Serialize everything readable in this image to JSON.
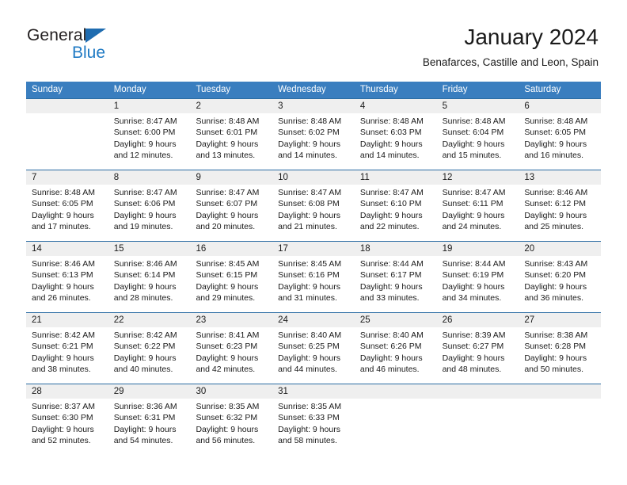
{
  "brand": {
    "name_part1": "General",
    "name_part2": "Blue",
    "triangle_icon": "triangle-icon",
    "color_dark": "#231f20",
    "color_blue": "#1f7ac4"
  },
  "header": {
    "title": "January 2024",
    "subtitle": "Benafarces, Castille and Leon, Spain"
  },
  "colors": {
    "header_band": "#3a7ebf",
    "daynum_band": "#efefef",
    "row_separator": "#2b6ca3",
    "text": "#1a1a1a"
  },
  "weekdays": [
    "Sunday",
    "Monday",
    "Tuesday",
    "Wednesday",
    "Thursday",
    "Friday",
    "Saturday"
  ],
  "weeks": [
    {
      "days": [
        {
          "num": "",
          "l1": "",
          "l2": "",
          "l3": "",
          "l4": ""
        },
        {
          "num": "1",
          "l1": "Sunrise: 8:47 AM",
          "l2": "Sunset: 6:00 PM",
          "l3": "Daylight: 9 hours",
          "l4": "and 12 minutes."
        },
        {
          "num": "2",
          "l1": "Sunrise: 8:48 AM",
          "l2": "Sunset: 6:01 PM",
          "l3": "Daylight: 9 hours",
          "l4": "and 13 minutes."
        },
        {
          "num": "3",
          "l1": "Sunrise: 8:48 AM",
          "l2": "Sunset: 6:02 PM",
          "l3": "Daylight: 9 hours",
          "l4": "and 14 minutes."
        },
        {
          "num": "4",
          "l1": "Sunrise: 8:48 AM",
          "l2": "Sunset: 6:03 PM",
          "l3": "Daylight: 9 hours",
          "l4": "and 14 minutes."
        },
        {
          "num": "5",
          "l1": "Sunrise: 8:48 AM",
          "l2": "Sunset: 6:04 PM",
          "l3": "Daylight: 9 hours",
          "l4": "and 15 minutes."
        },
        {
          "num": "6",
          "l1": "Sunrise: 8:48 AM",
          "l2": "Sunset: 6:05 PM",
          "l3": "Daylight: 9 hours",
          "l4": "and 16 minutes."
        }
      ]
    },
    {
      "days": [
        {
          "num": "7",
          "l1": "Sunrise: 8:48 AM",
          "l2": "Sunset: 6:05 PM",
          "l3": "Daylight: 9 hours",
          "l4": "and 17 minutes."
        },
        {
          "num": "8",
          "l1": "Sunrise: 8:47 AM",
          "l2": "Sunset: 6:06 PM",
          "l3": "Daylight: 9 hours",
          "l4": "and 19 minutes."
        },
        {
          "num": "9",
          "l1": "Sunrise: 8:47 AM",
          "l2": "Sunset: 6:07 PM",
          "l3": "Daylight: 9 hours",
          "l4": "and 20 minutes."
        },
        {
          "num": "10",
          "l1": "Sunrise: 8:47 AM",
          "l2": "Sunset: 6:08 PM",
          "l3": "Daylight: 9 hours",
          "l4": "and 21 minutes."
        },
        {
          "num": "11",
          "l1": "Sunrise: 8:47 AM",
          "l2": "Sunset: 6:10 PM",
          "l3": "Daylight: 9 hours",
          "l4": "and 22 minutes."
        },
        {
          "num": "12",
          "l1": "Sunrise: 8:47 AM",
          "l2": "Sunset: 6:11 PM",
          "l3": "Daylight: 9 hours",
          "l4": "and 24 minutes."
        },
        {
          "num": "13",
          "l1": "Sunrise: 8:46 AM",
          "l2": "Sunset: 6:12 PM",
          "l3": "Daylight: 9 hours",
          "l4": "and 25 minutes."
        }
      ]
    },
    {
      "days": [
        {
          "num": "14",
          "l1": "Sunrise: 8:46 AM",
          "l2": "Sunset: 6:13 PM",
          "l3": "Daylight: 9 hours",
          "l4": "and 26 minutes."
        },
        {
          "num": "15",
          "l1": "Sunrise: 8:46 AM",
          "l2": "Sunset: 6:14 PM",
          "l3": "Daylight: 9 hours",
          "l4": "and 28 minutes."
        },
        {
          "num": "16",
          "l1": "Sunrise: 8:45 AM",
          "l2": "Sunset: 6:15 PM",
          "l3": "Daylight: 9 hours",
          "l4": "and 29 minutes."
        },
        {
          "num": "17",
          "l1": "Sunrise: 8:45 AM",
          "l2": "Sunset: 6:16 PM",
          "l3": "Daylight: 9 hours",
          "l4": "and 31 minutes."
        },
        {
          "num": "18",
          "l1": "Sunrise: 8:44 AM",
          "l2": "Sunset: 6:17 PM",
          "l3": "Daylight: 9 hours",
          "l4": "and 33 minutes."
        },
        {
          "num": "19",
          "l1": "Sunrise: 8:44 AM",
          "l2": "Sunset: 6:19 PM",
          "l3": "Daylight: 9 hours",
          "l4": "and 34 minutes."
        },
        {
          "num": "20",
          "l1": "Sunrise: 8:43 AM",
          "l2": "Sunset: 6:20 PM",
          "l3": "Daylight: 9 hours",
          "l4": "and 36 minutes."
        }
      ]
    },
    {
      "days": [
        {
          "num": "21",
          "l1": "Sunrise: 8:42 AM",
          "l2": "Sunset: 6:21 PM",
          "l3": "Daylight: 9 hours",
          "l4": "and 38 minutes."
        },
        {
          "num": "22",
          "l1": "Sunrise: 8:42 AM",
          "l2": "Sunset: 6:22 PM",
          "l3": "Daylight: 9 hours",
          "l4": "and 40 minutes."
        },
        {
          "num": "23",
          "l1": "Sunrise: 8:41 AM",
          "l2": "Sunset: 6:23 PM",
          "l3": "Daylight: 9 hours",
          "l4": "and 42 minutes."
        },
        {
          "num": "24",
          "l1": "Sunrise: 8:40 AM",
          "l2": "Sunset: 6:25 PM",
          "l3": "Daylight: 9 hours",
          "l4": "and 44 minutes."
        },
        {
          "num": "25",
          "l1": "Sunrise: 8:40 AM",
          "l2": "Sunset: 6:26 PM",
          "l3": "Daylight: 9 hours",
          "l4": "and 46 minutes."
        },
        {
          "num": "26",
          "l1": "Sunrise: 8:39 AM",
          "l2": "Sunset: 6:27 PM",
          "l3": "Daylight: 9 hours",
          "l4": "and 48 minutes."
        },
        {
          "num": "27",
          "l1": "Sunrise: 8:38 AM",
          "l2": "Sunset: 6:28 PM",
          "l3": "Daylight: 9 hours",
          "l4": "and 50 minutes."
        }
      ]
    },
    {
      "days": [
        {
          "num": "28",
          "l1": "Sunrise: 8:37 AM",
          "l2": "Sunset: 6:30 PM",
          "l3": "Daylight: 9 hours",
          "l4": "and 52 minutes."
        },
        {
          "num": "29",
          "l1": "Sunrise: 8:36 AM",
          "l2": "Sunset: 6:31 PM",
          "l3": "Daylight: 9 hours",
          "l4": "and 54 minutes."
        },
        {
          "num": "30",
          "l1": "Sunrise: 8:35 AM",
          "l2": "Sunset: 6:32 PM",
          "l3": "Daylight: 9 hours",
          "l4": "and 56 minutes."
        },
        {
          "num": "31",
          "l1": "Sunrise: 8:35 AM",
          "l2": "Sunset: 6:33 PM",
          "l3": "Daylight: 9 hours",
          "l4": "and 58 minutes."
        },
        {
          "num": "",
          "l1": "",
          "l2": "",
          "l3": "",
          "l4": ""
        },
        {
          "num": "",
          "l1": "",
          "l2": "",
          "l3": "",
          "l4": ""
        },
        {
          "num": "",
          "l1": "",
          "l2": "",
          "l3": "",
          "l4": ""
        }
      ]
    }
  ]
}
